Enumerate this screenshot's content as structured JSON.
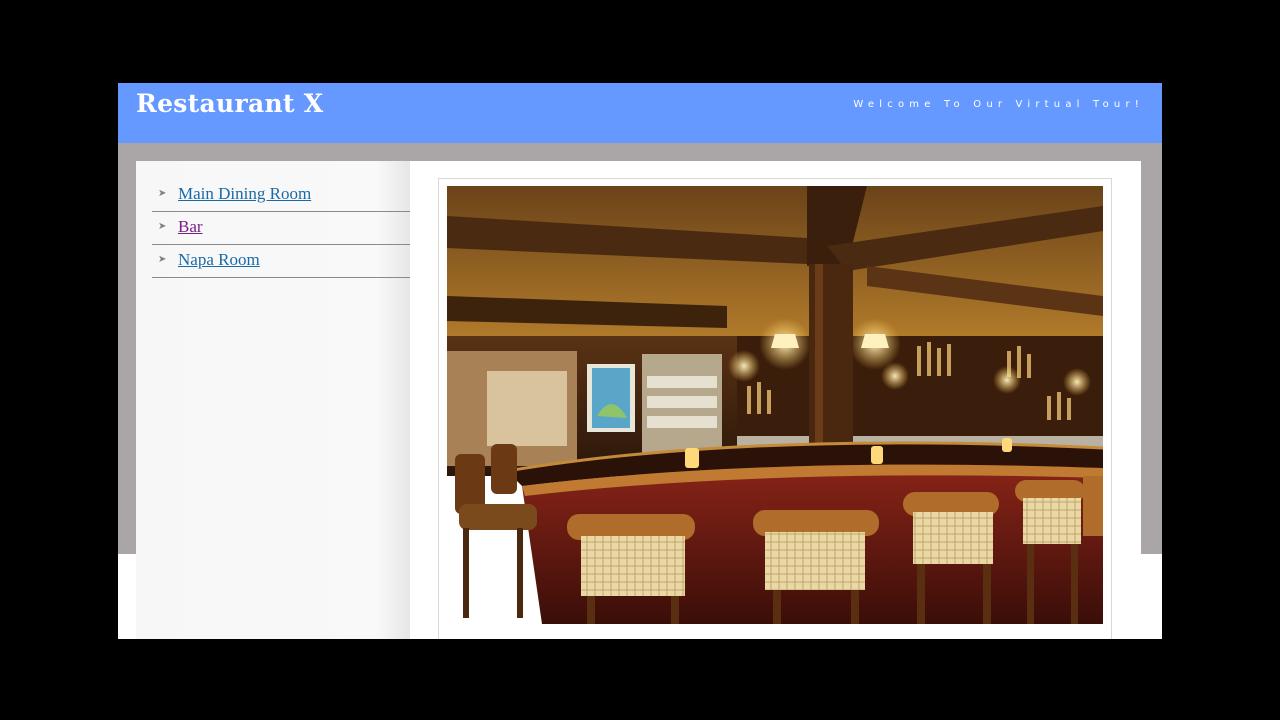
{
  "site": {
    "title": "Restaurant X",
    "tagline": "Welcome To Our Virtual Tour!"
  },
  "sidebar": {
    "items": [
      {
        "label": "Main Dining Room",
        "visited": false
      },
      {
        "label": "Bar",
        "visited": true
      },
      {
        "label": "Napa Room",
        "visited": false
      }
    ]
  },
  "main": {
    "photo": {
      "subject": "restaurant bar interior"
    }
  },
  "colors": {
    "header": "#6699ff",
    "band": "#aaa6a8",
    "link": "#1a6aa8",
    "link_visited": "#7a1f8a"
  }
}
